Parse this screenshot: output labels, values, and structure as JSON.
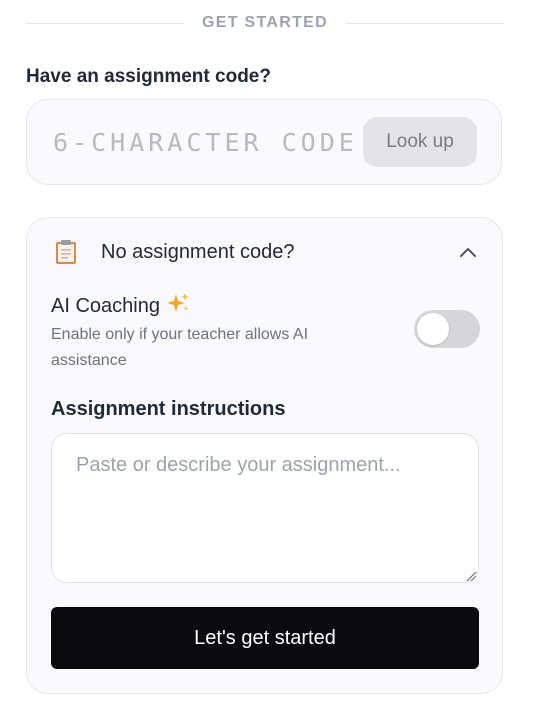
{
  "header": {
    "divider_text": "GET STARTED"
  },
  "code_section": {
    "label": "Have an assignment code?",
    "placeholder": "6-CHARACTER CODE",
    "value": "",
    "lookup_label": "Look up"
  },
  "card": {
    "title": "No assignment code?",
    "clipboard_icon": "clipboard-icon",
    "chevron_icon": "chevron-up-icon",
    "ai": {
      "title": "AI Coaching",
      "sparkle_icon": "sparkles-icon",
      "description": "Enable only if your teacher allows AI assistance",
      "enabled": false
    },
    "instructions": {
      "label": "Assignment instructions",
      "placeholder": "Paste or describe your assignment...",
      "value": ""
    },
    "submit_label": "Let's get started"
  },
  "colors": {
    "primary_button": "#0b0a10",
    "card_background": "#faf9fd",
    "toggle_off": "#d5d5dc",
    "sparkle": "#f5a623"
  }
}
